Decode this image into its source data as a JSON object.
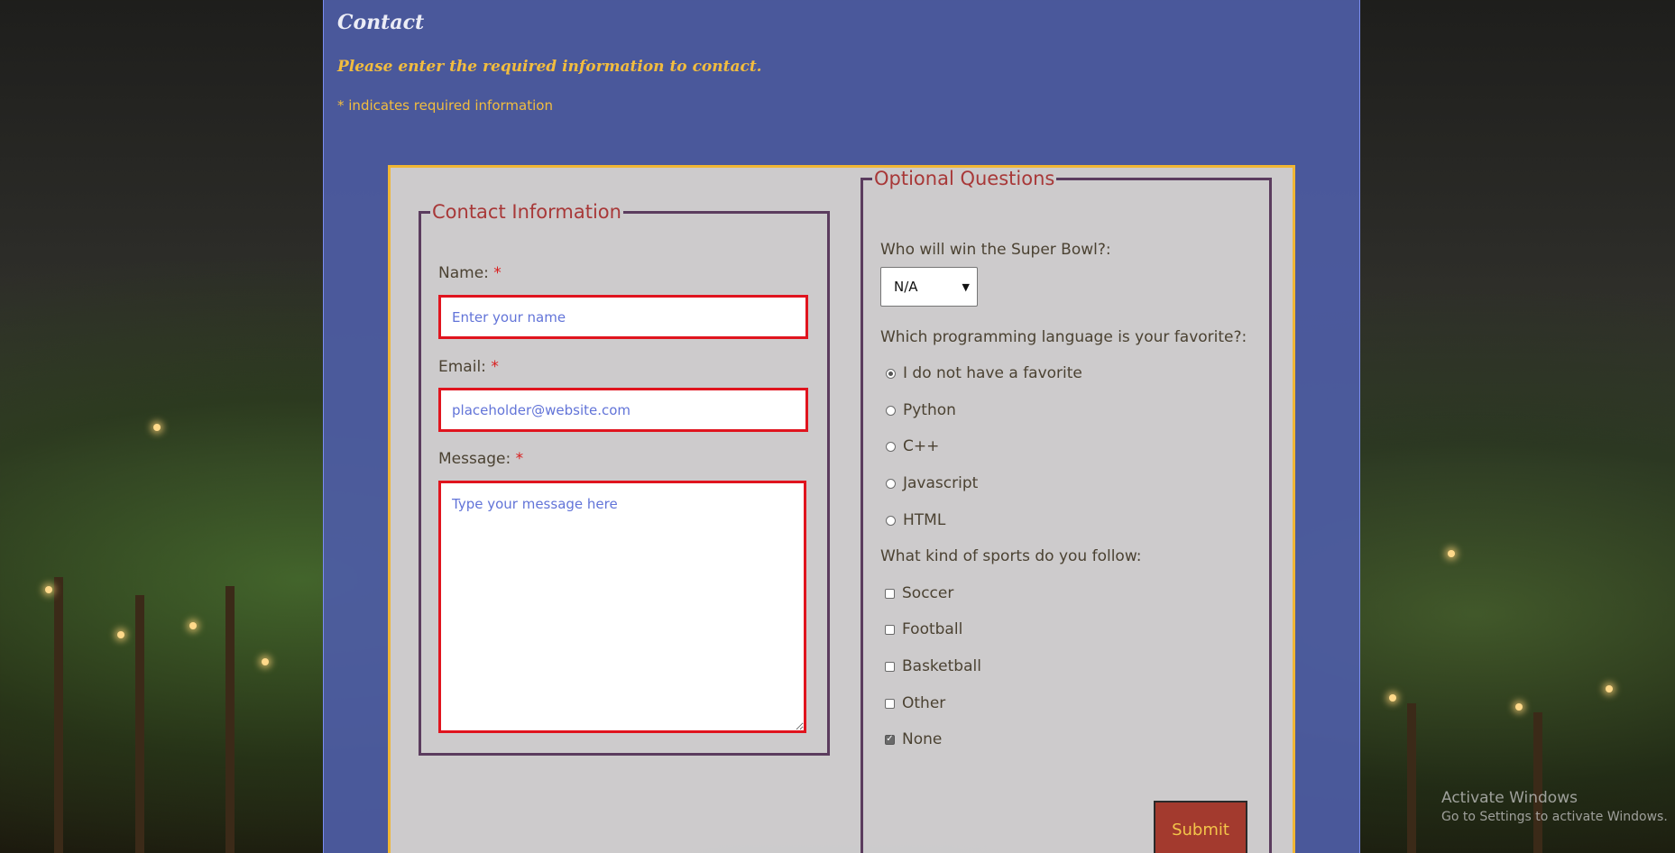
{
  "header": {
    "title": "Contact",
    "subtitle": "Please enter the required information to contact.",
    "required_note": "* indicates required information"
  },
  "contact_info": {
    "legend": "Contact Information",
    "name_label": "Name:",
    "name_placeholder": "Enter your name",
    "email_label": "Email:",
    "email_placeholder": "placeholder@website.com",
    "message_label": "Message:",
    "message_placeholder": "Type your message here",
    "required_marker": "*"
  },
  "optional": {
    "legend": "Optional Questions",
    "superbowl_question": "Who will win the Super Bowl?:",
    "superbowl_selected": "N/A",
    "language_question": "Which programming language is your favorite?:",
    "languages": [
      {
        "label": "I do not have a favorite",
        "checked": true
      },
      {
        "label": "Python",
        "checked": false
      },
      {
        "label": "C++",
        "checked": false
      },
      {
        "label": "Javascript",
        "checked": false
      },
      {
        "label": "HTML",
        "checked": false
      }
    ],
    "sports_question": "What kind of sports do you follow:",
    "sports": [
      {
        "label": "Soccer",
        "checked": false
      },
      {
        "label": "Football",
        "checked": false
      },
      {
        "label": "Basketball",
        "checked": false
      },
      {
        "label": "Other",
        "checked": false
      },
      {
        "label": "None",
        "checked": true
      }
    ],
    "submit_label": "Submit"
  },
  "watermark": {
    "title": "Activate Windows",
    "subtitle": "Go to Settings to activate Windows."
  },
  "colors": {
    "panel": "#4e5ca5",
    "accent": "#f2bd3f",
    "required_border": "#e0141e",
    "legend": "#a83838",
    "submit_bg": "#a33a2e"
  }
}
